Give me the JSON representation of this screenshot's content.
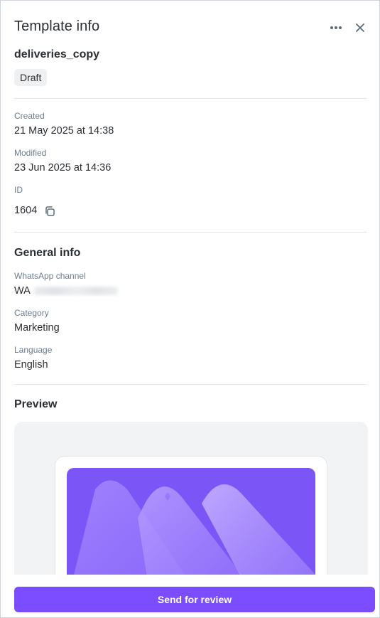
{
  "header": {
    "title": "Template info",
    "more_icon": "more-horizontal-icon",
    "close_icon": "close-icon"
  },
  "template": {
    "name": "deliveries_copy",
    "status": "Draft"
  },
  "meta": {
    "created_label": "Created",
    "created_value": "21 May 2025 at 14:38",
    "modified_label": "Modified",
    "modified_value": "23 Jun 2025 at 14:36",
    "id_label": "ID",
    "id_value": "1604",
    "copy_icon": "copy-icon"
  },
  "general": {
    "title": "General info",
    "channel_label": "WhatsApp channel",
    "channel_prefix": "WA",
    "category_label": "Category",
    "category_value": "Marketing",
    "language_label": "Language",
    "language_value": "English"
  },
  "preview": {
    "title": "Preview",
    "media_icon": "image-placeholder-icon"
  },
  "actions": {
    "send_label": "Send for review"
  },
  "colors": {
    "accent": "#7c4dff",
    "media_bg": "#7b55f6",
    "label": "#6b7d8f"
  }
}
